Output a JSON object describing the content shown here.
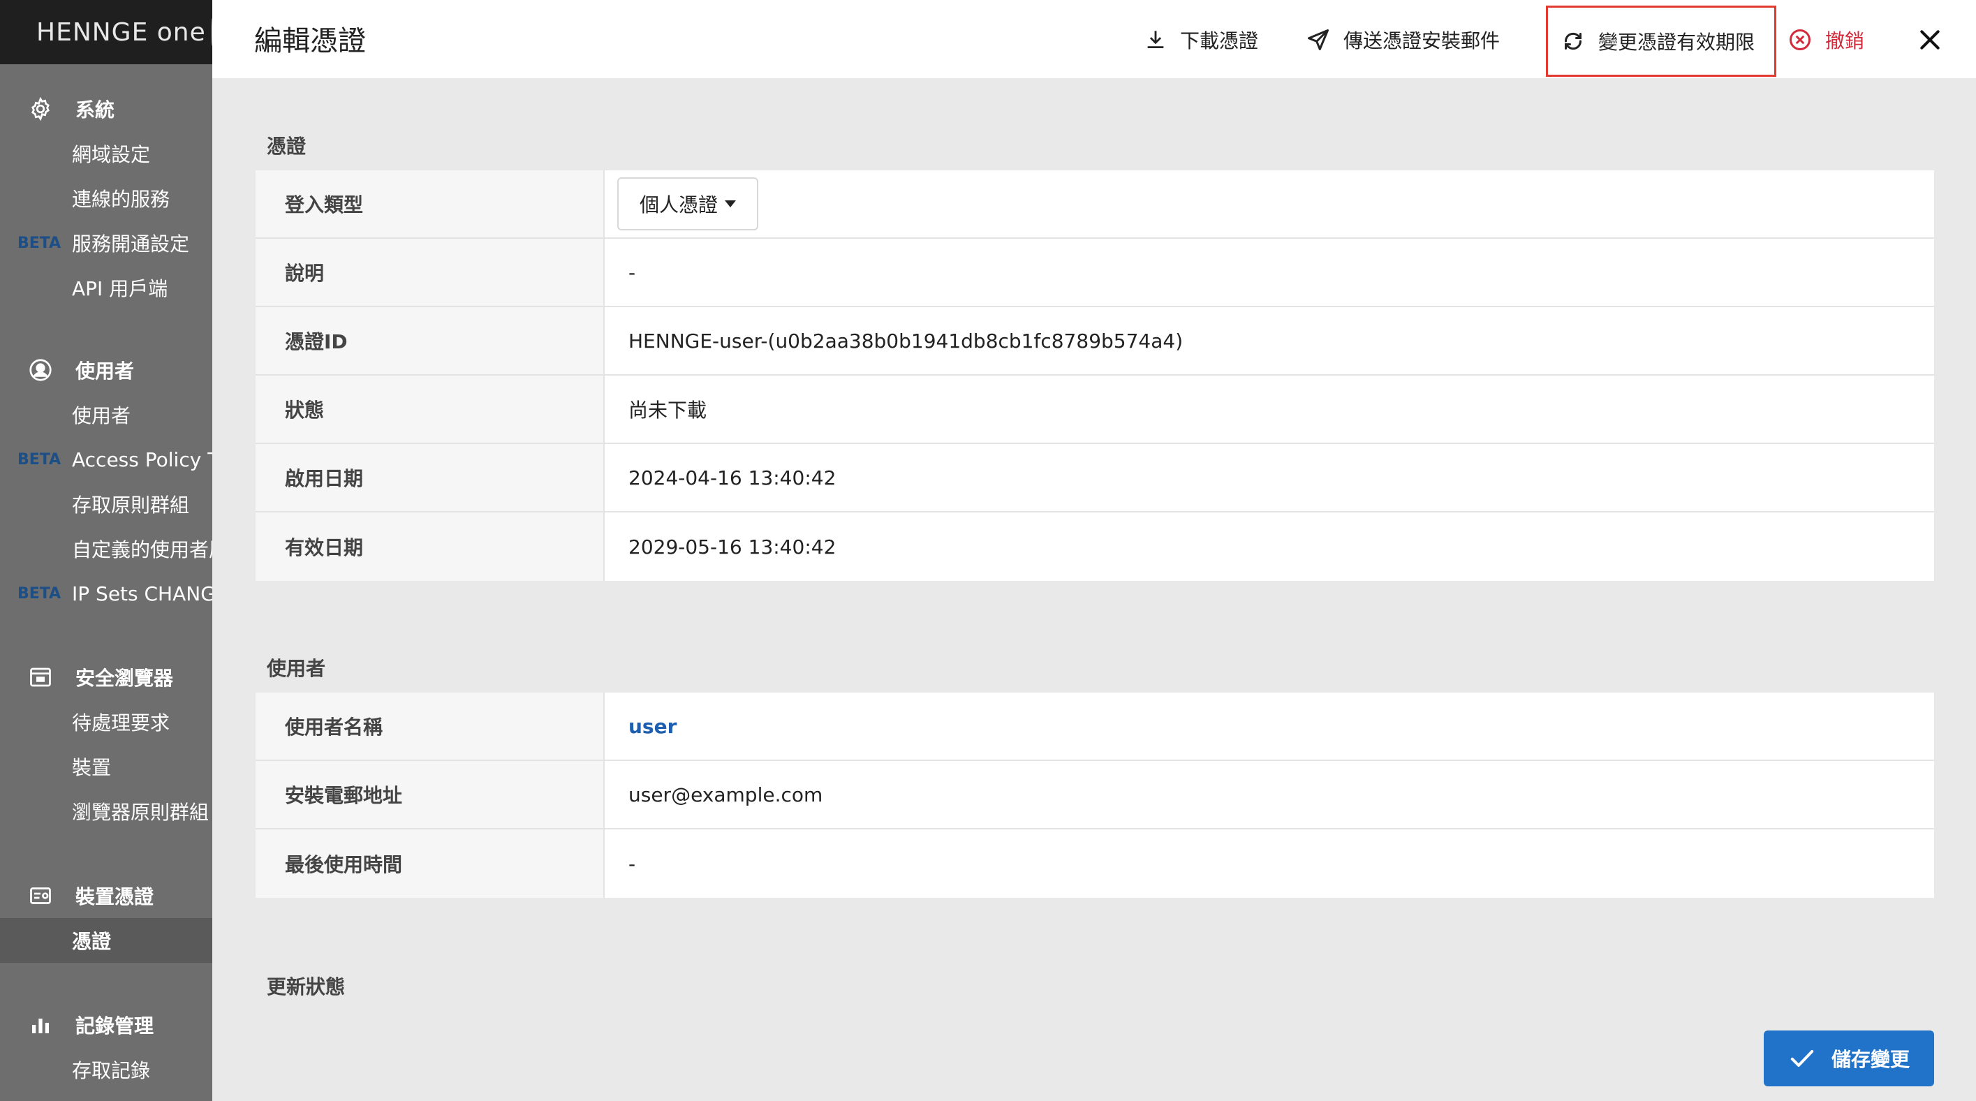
{
  "sidebar": {
    "logo_text": "HENNGE one",
    "sections": [
      {
        "heading": "系統",
        "icon": "gear-icon",
        "items": [
          {
            "label": "網域設定",
            "beta": ""
          },
          {
            "label": "連線的服務",
            "beta": ""
          },
          {
            "label": "服務開通設定",
            "beta": "BETA"
          },
          {
            "label": "API 用戶端",
            "beta": ""
          }
        ]
      },
      {
        "heading": "使用者",
        "icon": "user-circle-icon",
        "items": [
          {
            "label": "使用者",
            "beta": ""
          },
          {
            "label": "Access Policy Te",
            "beta": "BETA"
          },
          {
            "label": "存取原則群組",
            "beta": ""
          },
          {
            "label": "自定義的使用者屬",
            "beta": ""
          },
          {
            "label": "IP Sets CHANGE",
            "beta": "BETA"
          }
        ]
      },
      {
        "heading": "安全瀏覽器",
        "icon": "browser-window-icon",
        "items": [
          {
            "label": "待處理要求",
            "beta": ""
          },
          {
            "label": "裝置",
            "beta": ""
          },
          {
            "label": "瀏覽器原則群組",
            "beta": ""
          }
        ]
      },
      {
        "heading": "裝置憑證",
        "icon": "certificate-card-icon",
        "items": [
          {
            "label": "憑證",
            "beta": "",
            "active": true
          }
        ]
      },
      {
        "heading": "記錄管理",
        "icon": "bar-chart-icon",
        "items": [
          {
            "label": "存取記錄",
            "beta": ""
          }
        ]
      }
    ]
  },
  "header": {
    "title": "編輯憑證",
    "actions": {
      "download": "下載憑證",
      "send_mail": "傳送憑證安裝郵件",
      "change_validity": "變更憑證有效期限",
      "revoke": "撤銷"
    }
  },
  "certificate": {
    "section_title": "憑證",
    "rows": [
      {
        "label": "登入類型",
        "value": "個人憑證"
      },
      {
        "label": "說明",
        "value": "-"
      },
      {
        "label": "憑證ID",
        "value": "HENNGE-user-(u0b2aa38b0b1941db8cb1fc8789b574a4)"
      },
      {
        "label": "狀態",
        "value": "尚未下載"
      },
      {
        "label": "啟用日期",
        "value": "2024-04-16 13:40:42"
      },
      {
        "label": "有效日期",
        "value": "2029-05-16 13:40:42"
      }
    ]
  },
  "user": {
    "section_title": "使用者",
    "rows": [
      {
        "label": "使用者名稱",
        "value": "user"
      },
      {
        "label": "安裝電郵地址",
        "value": "user@example.com"
      },
      {
        "label": "最後使用時間",
        "value": "-"
      }
    ]
  },
  "update_status": {
    "section_title": "更新狀態"
  },
  "footer": {
    "save_label": "儲存變更"
  },
  "colors": {
    "highlight_border": "#e23a2f",
    "revoke": "#d22a3a",
    "primary": "#2173c9",
    "link": "#1d5fae",
    "beta": "#1d4e85"
  }
}
